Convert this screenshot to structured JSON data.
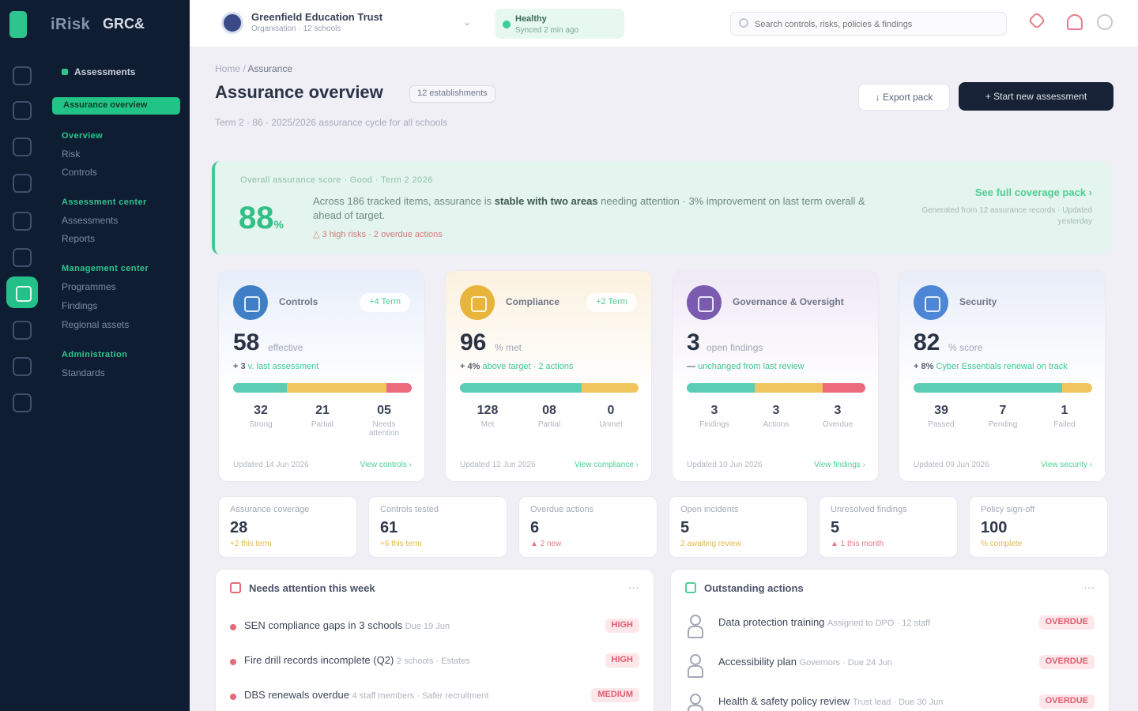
{
  "brand": {
    "name": "iRisk",
    "code": "GRC&"
  },
  "nav": {
    "group_label": "Assessments",
    "active_item": "Assurance overview",
    "sections": [
      {
        "title": "Overview",
        "items": [
          "Risk",
          "Controls"
        ]
      },
      {
        "title": "Assessment center",
        "items": [
          "Assessments",
          "Reports"
        ]
      },
      {
        "title": "Management center",
        "items": [
          "Programmes",
          "Findings",
          "Regional assets"
        ]
      },
      {
        "title": "Administration",
        "items": [
          "Standards"
        ]
      }
    ]
  },
  "topbar": {
    "org_name": "Greenfield Education Trust",
    "org_sub": "Organisation · 12 schools",
    "status_title": "Healthy",
    "status_sub": "Synced 2 min ago",
    "search_placeholder": "Search controls, risks, policies & findings"
  },
  "header": {
    "breadcrumb_root": "Home",
    "breadcrumb_current": "Assurance",
    "title": "Assurance overview",
    "badge": "12 establishments",
    "subtitle": "Term 2 · 86 · 2025/2026 assurance cycle for all schools",
    "export_label": "↓ Export pack",
    "primary_label": "+ Start new assessment"
  },
  "banner": {
    "eyebrow": "Overall assurance score · Good · Term 2 2026",
    "score": "88",
    "score_unit": "%",
    "text_prefix": "Across 186 tracked items, assurance is ",
    "text_bold": "stable with two areas",
    "text_suffix": " needing attention · 3% improvement on last term overall & ahead of target.",
    "note": "△ 3 high risks · 2 overdue actions",
    "link": "See full coverage pack ›",
    "link_sub": "Generated from 12 assurance records · Updated yesterday"
  },
  "cards": [
    {
      "name": "Controls",
      "chip": "+4 Term",
      "value": "58",
      "unit": "effective",
      "trend_label": "+ 3",
      "trend_text": "v. last assessment",
      "accent": "#3f7fc6",
      "head_tint": "#e7eefa",
      "segments": [
        0.3,
        0.56,
        0.14
      ],
      "stats": [
        {
          "n": "32",
          "l": "Strong"
        },
        {
          "n": "21",
          "l": "Partial"
        },
        {
          "n": "05",
          "l": "Needs attention"
        }
      ],
      "foot": "Updated 14 Jun 2026",
      "link": "View controls ›"
    },
    {
      "name": "Compliance",
      "chip": "+2 Term",
      "value": "96",
      "unit": "% met",
      "trend_label": "+ 4%",
      "trend_text": "above target · 2 actions",
      "accent": "#e9b43a",
      "head_tint": "#fbf1df",
      "segments": [
        0.68,
        0.32,
        0.0
      ],
      "stats": [
        {
          "n": "128",
          "l": "Met"
        },
        {
          "n": "08",
          "l": "Partial"
        },
        {
          "n": "0",
          "l": "Unmet"
        }
      ],
      "foot": "Updated 12 Jun 2026",
      "link": "View compliance ›"
    },
    {
      "name": "Governance & Oversight",
      "chip": "",
      "value": "3",
      "unit": "open findings",
      "trend_label": "—",
      "trend_text": "unchanged from last review",
      "accent": "#7a5bb0",
      "head_tint": "#efe8f6",
      "segments": [
        0.38,
        0.38,
        0.24
      ],
      "stats": [
        {
          "n": "3",
          "l": "Findings"
        },
        {
          "n": "3",
          "l": "Actions"
        },
        {
          "n": "3",
          "l": "Overdue"
        }
      ],
      "foot": "Updated 10 Jun 2026",
      "link": "View findings ›"
    },
    {
      "name": "Security",
      "chip": "",
      "value": "82",
      "unit": "% score",
      "trend_label": "+ 8%",
      "trend_text": "Cyber Essentials renewal on track",
      "accent": "#4d86d6",
      "head_tint": "#e8edf8",
      "segments": [
        0.83,
        0.17,
        0.0
      ],
      "stats": [
        {
          "n": "39",
          "l": "Passed"
        },
        {
          "n": "7",
          "l": "Pending"
        },
        {
          "n": "1",
          "l": "Failed"
        }
      ],
      "foot": "Updated 09 Jun 2026",
      "link": "View security ›"
    }
  ],
  "kpis": [
    {
      "title": "Assurance coverage",
      "value": "28",
      "sub": "+2 this term",
      "color": "#e1b94a"
    },
    {
      "title": "Controls tested",
      "value": "61",
      "sub": "+6 this term",
      "color": "#e1b94a"
    },
    {
      "title": "Overdue actions",
      "value": "6",
      "sub": "▲ 2 new",
      "color": "#e57a88"
    },
    {
      "title": "Open incidents",
      "value": "5",
      "sub": "2 awaiting review",
      "color": "#e1b94a"
    },
    {
      "title": "Unresolved findings",
      "value": "5",
      "sub": "▲ 1 this month",
      "color": "#e57a88"
    },
    {
      "title": "Policy sign-off",
      "value": "100",
      "sub": "% complete",
      "color": "#e1b94a"
    }
  ],
  "risks_panel": {
    "title": "Needs attention this week",
    "more": "···",
    "rows": [
      {
        "text": "SEN compliance gaps in 3 schools",
        "meta": "Due 19 Jun",
        "tag": "HIGH"
      },
      {
        "text": "Fire drill records incomplete (Q2)",
        "meta": "2 schools · Estates",
        "tag": "HIGH"
      },
      {
        "text": "DBS renewals overdue",
        "meta": "4 staff members · Safer recruitment",
        "tag": "MEDIUM"
      }
    ]
  },
  "actions_panel": {
    "title": "Outstanding actions",
    "more": "···",
    "rows": [
      {
        "text": "Data protection training",
        "meta": "Assigned to DPO · 12 staff",
        "tag": "OVERDUE"
      },
      {
        "text": "Accessibility plan",
        "meta": "Governors · Due 24 Jun",
        "tag": "OVERDUE"
      },
      {
        "text": "Health & safety policy review",
        "meta": "Trust lead · Due 30 Jun",
        "tag": "OVERDUE"
      }
    ]
  },
  "colors": {
    "accent": "#2fc48d",
    "sidebar": "#0f1d33",
    "danger": "#e25b6f"
  }
}
